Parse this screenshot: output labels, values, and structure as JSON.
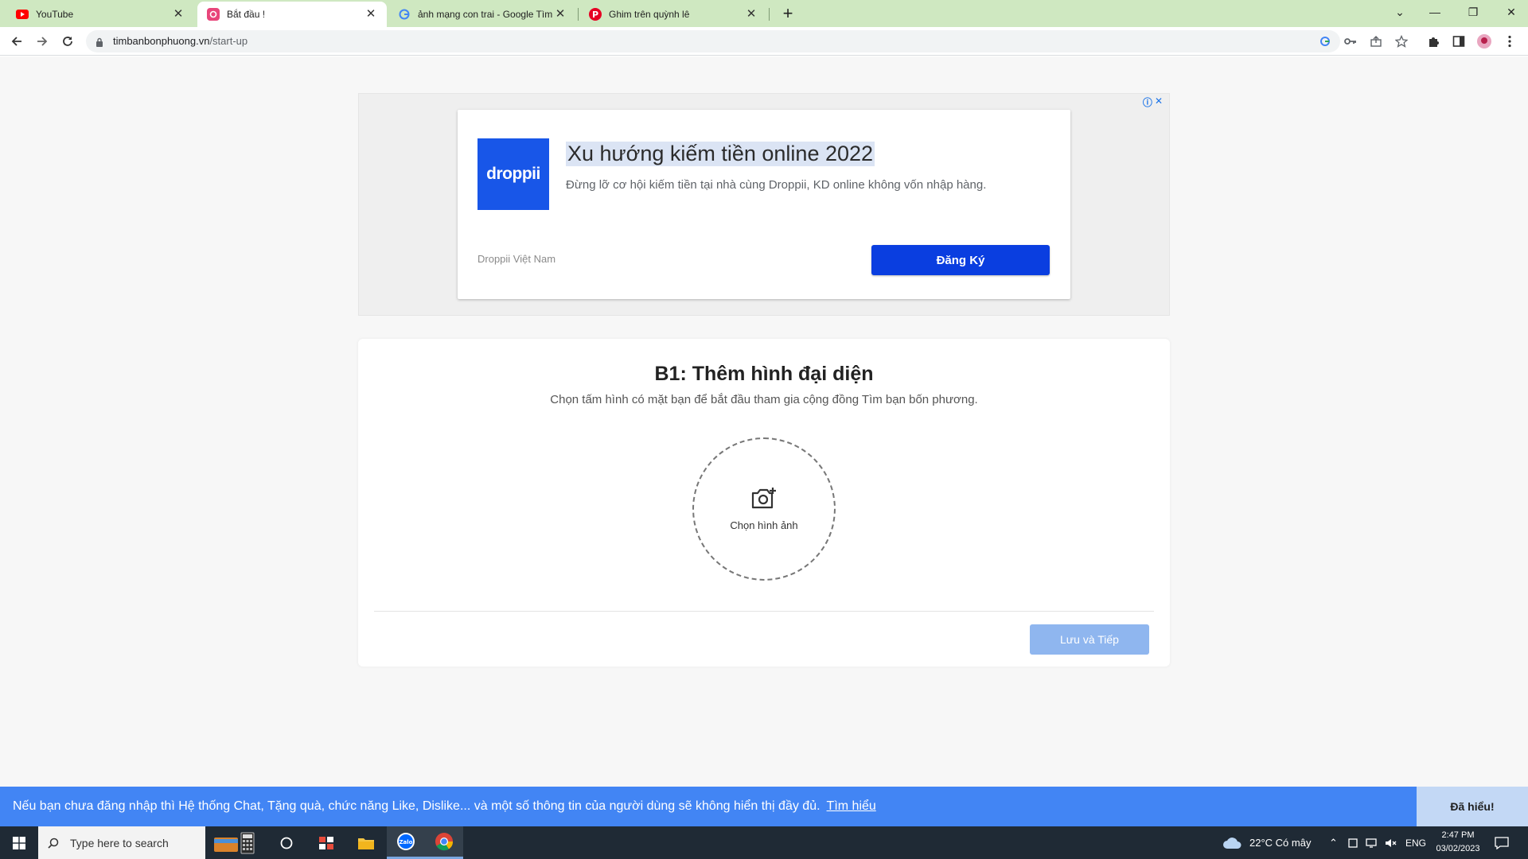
{
  "browser": {
    "tabs": [
      {
        "title": "YouTube",
        "icon": "youtube-icon",
        "active": false
      },
      {
        "title": "Bắt đầu !",
        "icon": "site-favicon-icon",
        "active": true
      },
      {
        "title": "ảnh mạng con trai - Google Tìm",
        "icon": "google-icon",
        "active": false
      },
      {
        "title": "Ghim trên quỳnh lê",
        "icon": "pinterest-icon",
        "active": false
      }
    ],
    "url_host": "timbanbonphuong.vn",
    "url_path": "/start-up"
  },
  "ad": {
    "logo_text": "droppii",
    "title": "Xu hướng kiếm tiền online 2022",
    "description": "Đừng lỡ cơ hội kiếm tiền tại nhà cùng Droppii, KD online không vốn nhập hàng.",
    "advertiser": "Droppii Việt Nam",
    "cta_label": "Đăng Ký"
  },
  "step": {
    "title": "B1: Thêm hình đại diện",
    "subtitle": "Chọn tấm hình có mặt bạn để bắt đầu tham gia cộng đồng Tìm bạn bốn phương.",
    "picker_label": "Chọn hình ảnh",
    "save_label": "Lưu và Tiếp"
  },
  "notice": {
    "message": "Nếu bạn chưa đăng nhập thì Hệ thống Chat, Tặng quà, chức năng Like, Dislike... và một số thông tin của người dùng sẽ không hiển thị đầy đủ.",
    "link_label": "Tìm hiểu",
    "dismiss_label": "Đã hiểu!"
  },
  "taskbar": {
    "search_placeholder": "Type here to search",
    "weather": "22°C  Có mây",
    "language": "ENG",
    "time": "2:47 PM",
    "date": "03/02/2023"
  },
  "colors": {
    "tabstrip": "#cfe8c1",
    "ad_cta": "#0a3ee0",
    "droppii_brand": "#1856e8",
    "notice_bar": "#4285f4",
    "save_button_disabled": "#8fb6ef"
  }
}
